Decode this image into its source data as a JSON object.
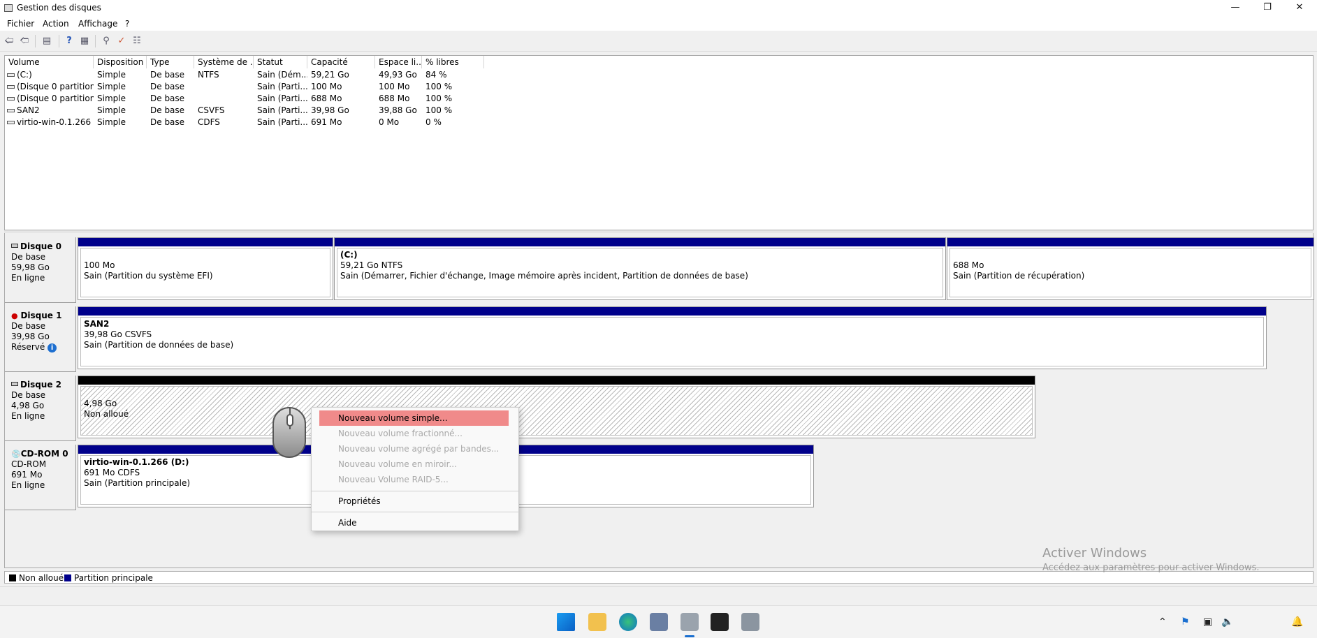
{
  "window": {
    "title": "Gestion des disques"
  },
  "menu": [
    "Fichier",
    "Action",
    "Affichage",
    "?"
  ],
  "table": {
    "columns": [
      "Volume",
      "Disposition",
      "Type",
      "Système de ...",
      "Statut",
      "Capacité",
      "Espace li...",
      "% libres"
    ],
    "rows": [
      [
        "(C:)",
        "Simple",
        "De base",
        "NTFS",
        "Sain (Dém...",
        "59,21 Go",
        "49,93 Go",
        "84 %"
      ],
      [
        "(Disque 0 partition...",
        "Simple",
        "De base",
        "",
        "Sain (Parti...",
        "100 Mo",
        "100 Mo",
        "100 %"
      ],
      [
        "(Disque 0 partition...",
        "Simple",
        "De base",
        "",
        "Sain (Parti...",
        "688 Mo",
        "688 Mo",
        "100 %"
      ],
      [
        "SAN2",
        "Simple",
        "De base",
        "CSVFS",
        "Sain (Parti...",
        "39,98 Go",
        "39,88 Go",
        "100 %"
      ],
      [
        "virtio-win-0.1.266 ...",
        "Simple",
        "De base",
        "CDFS",
        "Sain (Parti...",
        "691 Mo",
        "0 Mo",
        "0 %"
      ]
    ]
  },
  "disks": [
    {
      "name": "Disque 0",
      "type": "De base",
      "size": "59,98 Go",
      "status": "En ligne",
      "partitions": [
        {
          "title": "",
          "line1": "100 Mo",
          "line2": "Sain (Partition du système EFI)"
        },
        {
          "title": "(C:)",
          "line1": "59,21 Go NTFS",
          "line2": "Sain (Démarrer, Fichier d'échange, Image mémoire après incident, Partition de données de base)"
        },
        {
          "title": "",
          "line1": "688 Mo",
          "line2": "Sain (Partition de récupération)"
        }
      ]
    },
    {
      "name": "Disque 1",
      "type": "De base",
      "size": "39,98 Go",
      "status": "Réservé",
      "partitions": [
        {
          "title": "SAN2",
          "line1": "39,98 Go CSVFS",
          "line2": "Sain (Partition de données de base)"
        }
      ]
    },
    {
      "name": "Disque 2",
      "type": "De base",
      "size": "4,98 Go",
      "status": "En ligne",
      "partitions": [
        {
          "title": "",
          "line1": "4,98 Go",
          "line2": "Non alloué"
        }
      ]
    },
    {
      "name": "CD-ROM 0",
      "type": "CD-ROM",
      "size": "691 Mo",
      "status": "En ligne",
      "partitions": [
        {
          "title": "virtio-win-0.1.266  (D:)",
          "line1": "691 Mo CDFS",
          "line2": "Sain (Partition principale)"
        }
      ]
    }
  ],
  "legend": [
    {
      "label": "Non alloué",
      "color": "#000000"
    },
    {
      "label": "Partition principale",
      "color": "#00008b"
    }
  ],
  "context_menu": {
    "items": [
      {
        "label": "Nouveau volume simple...",
        "enabled": true,
        "highlighted": true
      },
      {
        "label": "Nouveau volume fractionné...",
        "enabled": false
      },
      {
        "label": "Nouveau volume agrégé par bandes...",
        "enabled": false
      },
      {
        "label": "Nouveau volume en miroir...",
        "enabled": false
      },
      {
        "label": "Nouveau Volume RAID-5...",
        "enabled": false
      },
      {
        "label": "Propriétés",
        "enabled": true
      },
      {
        "label": "Aide",
        "enabled": true
      }
    ]
  },
  "watermark": {
    "title": "Activer Windows",
    "subtitle": "Accédez aux paramètres pour activer Windows."
  },
  "colors": {
    "primary_partition": "#00008b",
    "unallocated": "#000000",
    "highlight": "#f08a8a"
  },
  "taskbar_icons": [
    "start-icon",
    "file-explorer-icon",
    "edge-icon",
    "server-manager-icon",
    "disk-management-icon",
    "terminal-icon",
    "settings-icon"
  ]
}
